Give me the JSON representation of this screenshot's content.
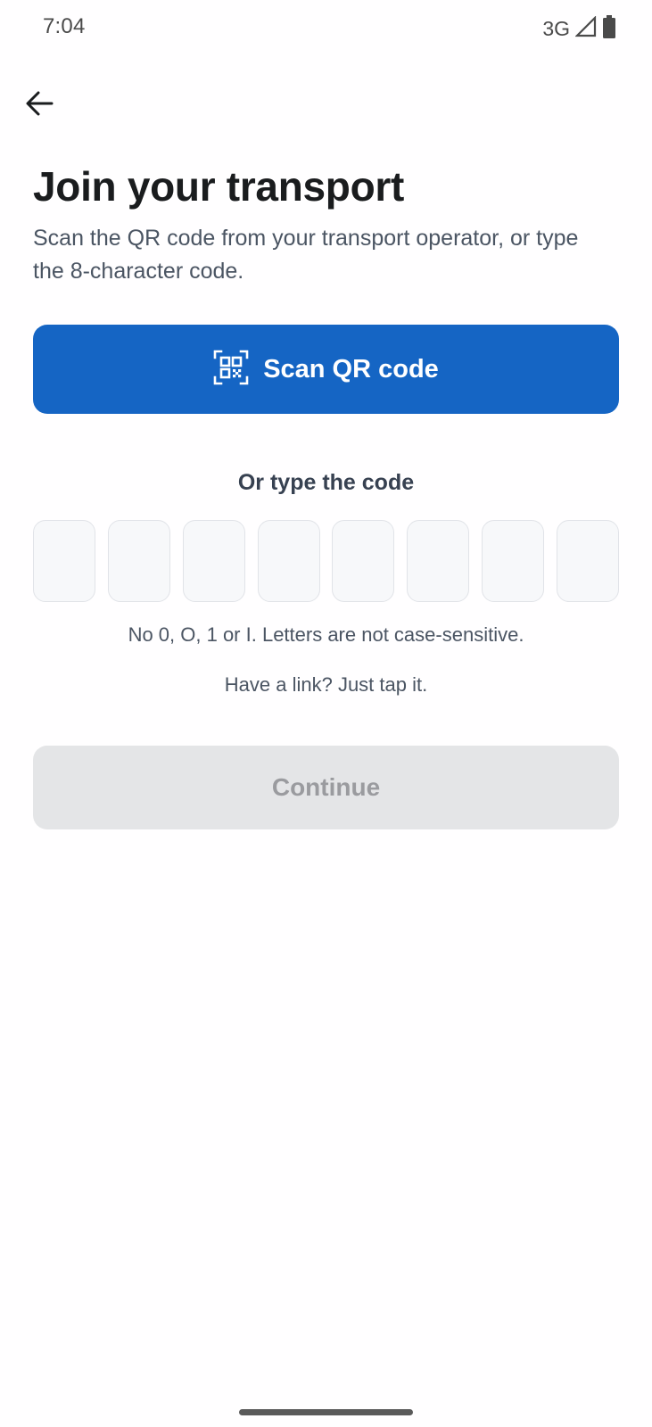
{
  "status_bar": {
    "time": "7:04",
    "network": "3G",
    "icons": [
      "signal-icon",
      "battery-icon"
    ]
  },
  "nav": {
    "back_icon": "arrow-left-icon"
  },
  "header": {
    "title": "Join your transport",
    "subtitle": "Scan the QR code from your transport operator, or type the 8-character code."
  },
  "scan": {
    "label": "Scan QR code",
    "icon": "qr-scan-icon",
    "color": "#1565C4"
  },
  "code_entry": {
    "label": "Or type the code",
    "slots": [
      "",
      "",
      "",
      "",
      "",
      "",
      "",
      ""
    ],
    "hint": "No 0, O, 1 or I. Letters are not case-sensitive.",
    "link_hint": "Have a link? Just tap it."
  },
  "continue": {
    "label": "Continue",
    "enabled": false
  }
}
